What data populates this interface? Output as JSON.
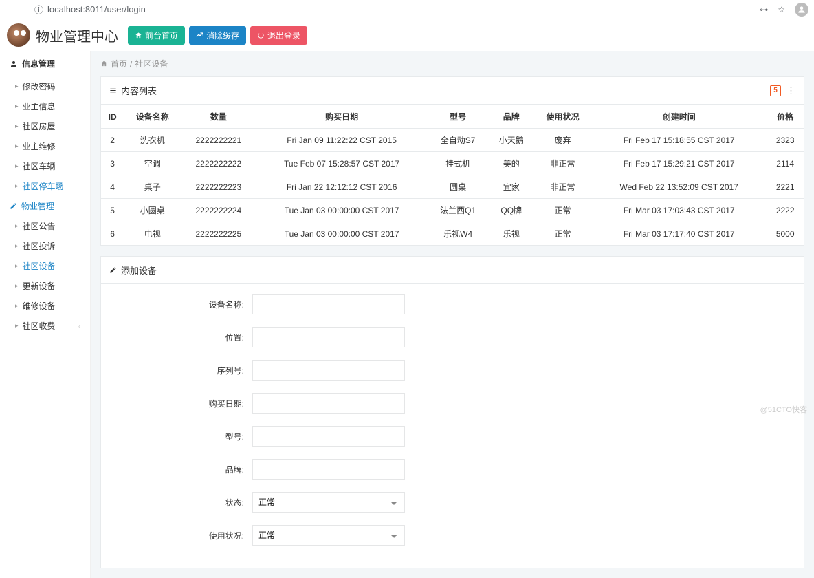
{
  "browser": {
    "url": "localhost:8011/user/login"
  },
  "header": {
    "brand": "物业管理中心",
    "btn_front": "前台首页",
    "btn_clear": "消除缓存",
    "btn_logout": "退出登录"
  },
  "sidebar": {
    "section_info": "信息管理",
    "info_items": [
      "修改密码",
      "业主信息",
      "社区房屋",
      "业主维修",
      "社区车辆",
      "社区停车场"
    ],
    "section_prop": "物业管理",
    "prop_items": [
      "社区公告",
      "社区投诉",
      "社区设备",
      "更新设备",
      "维修设备",
      "社区收费"
    ],
    "active_prop_index": 2
  },
  "breadcrumb": {
    "home": "首页",
    "current": "社区设备"
  },
  "panel_list": {
    "title": "内容列表",
    "columns": [
      "ID",
      "设备名称",
      "数量",
      "购买日期",
      "型号",
      "品牌",
      "使用状况",
      "创建时间",
      "价格"
    ],
    "rows": [
      {
        "id": "2",
        "name": "洗衣机",
        "qty": "2222222221",
        "buy": "Fri Jan 09 11:22:22 CST 2015",
        "model": "全自动S7",
        "brand": "小天鹅",
        "status": "废弃",
        "created": "Fri Feb 17 15:18:55 CST 2017",
        "price": "2323"
      },
      {
        "id": "3",
        "name": "空调",
        "qty": "2222222222",
        "buy": "Tue Feb 07 15:28:57 CST 2017",
        "model": "挂式机",
        "brand": "美的",
        "status": "非正常",
        "created": "Fri Feb 17 15:29:21 CST 2017",
        "price": "2114"
      },
      {
        "id": "4",
        "name": "桌子",
        "qty": "2222222223",
        "buy": "Fri Jan 22 12:12:12 CST 2016",
        "model": "圆桌",
        "brand": "宜家",
        "status": "非正常",
        "created": "Wed Feb 22 13:52:09 CST 2017",
        "price": "2221"
      },
      {
        "id": "5",
        "name": "小圆桌",
        "qty": "2222222224",
        "buy": "Tue Jan 03 00:00:00 CST 2017",
        "model": "法兰西Q1",
        "brand": "QQ牌",
        "status": "正常",
        "created": "Fri Mar 03 17:03:43 CST 2017",
        "price": "2222"
      },
      {
        "id": "6",
        "name": "电视",
        "qty": "2222222225",
        "buy": "Tue Jan 03 00:00:00 CST 2017",
        "model": "乐视W4",
        "brand": "乐视",
        "status": "正常",
        "created": "Fri Mar 03 17:17:40 CST 2017",
        "price": "5000"
      }
    ]
  },
  "panel_add": {
    "title": "添加设备",
    "labels": {
      "name": "设备名称:",
      "pos": "位置:",
      "serial": "序列号:",
      "buy": "购买日期:",
      "model": "型号:",
      "brand": "品牌:",
      "state": "状态:",
      "usage": "使用状况:"
    },
    "state_value": "正常",
    "usage_value": "正常"
  },
  "watermark": "@51CTO快客"
}
